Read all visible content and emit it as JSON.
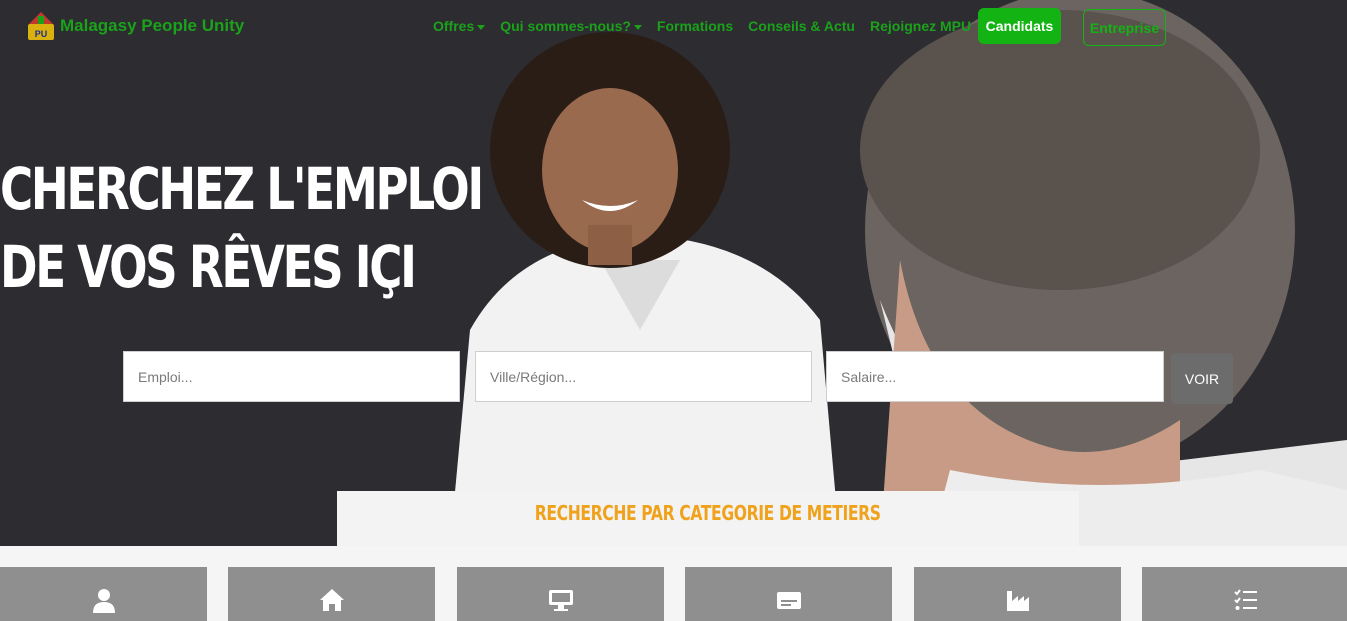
{
  "brand": {
    "name": "Malagasy People Unity",
    "logo_icon": "mpu-logo-icon"
  },
  "nav": {
    "items": [
      {
        "label": "Offres",
        "dropdown": true
      },
      {
        "label": "Qui sommes-nous?",
        "dropdown": true
      },
      {
        "label": "Formations",
        "dropdown": false
      },
      {
        "label": "Conseils & Actu",
        "dropdown": false
      },
      {
        "label": "Rejoignez MPU",
        "dropdown": false
      }
    ],
    "candidats_label": "Candidats",
    "entreprise_label": "Entreprise"
  },
  "hero": {
    "headline_line1": "CHERCHEZ L'EMPLOI",
    "headline_line2": "DE VOS RÊVES IÇI"
  },
  "search": {
    "emploi_placeholder": "Emploi...",
    "ville_placeholder": "Ville/Région...",
    "salaire_placeholder": "Salaire...",
    "submit_label": "VOIR"
  },
  "categories": {
    "title": "RECHERCHE PAR CATEGORIE DE METIERS",
    "items": [
      {
        "icon": "user-icon"
      },
      {
        "icon": "home-icon"
      },
      {
        "icon": "desktop-icon"
      },
      {
        "icon": "id-card-icon"
      },
      {
        "icon": "industry-icon"
      },
      {
        "icon": "checklist-icon"
      }
    ]
  },
  "colors": {
    "brand_green": "#1aa21a",
    "hero_bg": "#2d2c31",
    "accent_orange": "#f0a21c",
    "card_gray": "#8f8f8f"
  }
}
